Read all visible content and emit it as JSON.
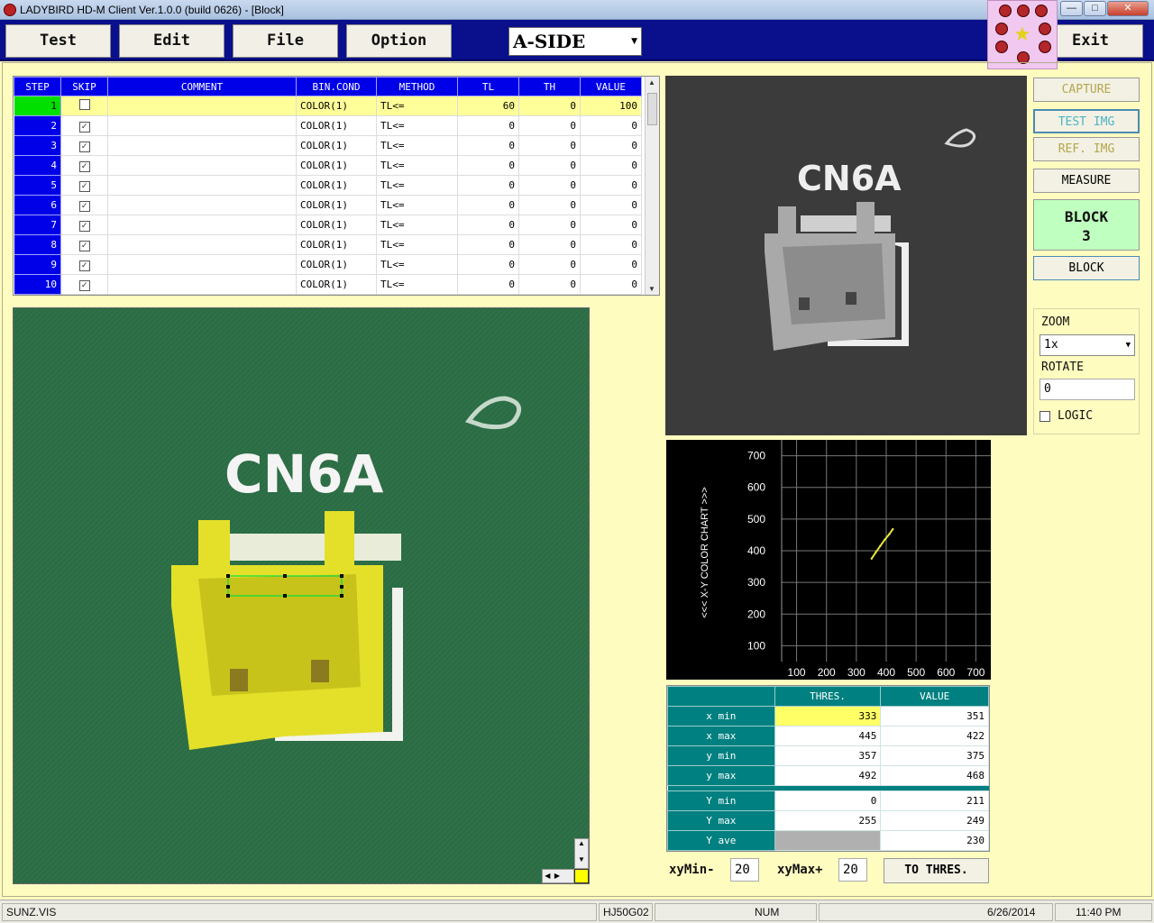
{
  "window": {
    "title": "LADYBIRD HD-M Client Ver.1.0.0  (build 0626) - [Block]",
    "minimize": "—",
    "maximize": "□",
    "close": "✕"
  },
  "toolbar": {
    "test": "Test",
    "edit": "Edit",
    "file": "File",
    "option": "Option",
    "side": "A-SIDE",
    "exit": "Exit"
  },
  "grid": {
    "headers": [
      "STEP",
      "SKIP",
      "COMMENT",
      "BIN.COND",
      "METHOD",
      "TL",
      "TH",
      "VALUE"
    ],
    "rows": [
      {
        "step": "1",
        "skip": false,
        "comment": "",
        "bin": "COLOR(1)",
        "method": "TL<=",
        "tl": "60",
        "th": "0",
        "value": "100"
      },
      {
        "step": "2",
        "skip": true,
        "comment": "",
        "bin": "COLOR(1)",
        "method": "TL<=",
        "tl": "0",
        "th": "0",
        "value": "0"
      },
      {
        "step": "3",
        "skip": true,
        "comment": "",
        "bin": "COLOR(1)",
        "method": "TL<=",
        "tl": "0",
        "th": "0",
        "value": "0"
      },
      {
        "step": "4",
        "skip": true,
        "comment": "",
        "bin": "COLOR(1)",
        "method": "TL<=",
        "tl": "0",
        "th": "0",
        "value": "0"
      },
      {
        "step": "5",
        "skip": true,
        "comment": "",
        "bin": "COLOR(1)",
        "method": "TL<=",
        "tl": "0",
        "th": "0",
        "value": "0"
      },
      {
        "step": "6",
        "skip": true,
        "comment": "",
        "bin": "COLOR(1)",
        "method": "TL<=",
        "tl": "0",
        "th": "0",
        "value": "0"
      },
      {
        "step": "7",
        "skip": true,
        "comment": "",
        "bin": "COLOR(1)",
        "method": "TL<=",
        "tl": "0",
        "th": "0",
        "value": "0"
      },
      {
        "step": "8",
        "skip": true,
        "comment": "",
        "bin": "COLOR(1)",
        "method": "TL<=",
        "tl": "0",
        "th": "0",
        "value": "0"
      },
      {
        "step": "9",
        "skip": true,
        "comment": "",
        "bin": "COLOR(1)",
        "method": "TL<=",
        "tl": "0",
        "th": "0",
        "value": "0"
      },
      {
        "step": "10",
        "skip": true,
        "comment": "",
        "bin": "COLOR(1)",
        "method": "TL<=",
        "tl": "0",
        "th": "0",
        "value": "0"
      }
    ]
  },
  "images": {
    "silkscreen": "CN6A"
  },
  "side_panel": {
    "capture": "CAPTURE",
    "test_img": "TEST IMG",
    "ref_img": "REF. IMG",
    "measure": "MEASURE",
    "block_label": "BLOCK",
    "block_number": "3",
    "block_button": "BLOCK",
    "zoom_label": "ZOOM",
    "zoom_value": "1x",
    "rotate_label": "ROTATE",
    "rotate_value": "0",
    "logic_label": "LOGIC",
    "logic_checked": false
  },
  "chart_data": {
    "type": "scatter",
    "title": "",
    "ylabel": "<<<  X-Y COLOR CHART  >>>",
    "xlabel": "",
    "xlim": [
      100,
      700
    ],
    "ylim": [
      100,
      700
    ],
    "x_ticks": [
      "100",
      "200",
      "300",
      "400",
      "500",
      "600",
      "700"
    ],
    "y_ticks": [
      "100",
      "200",
      "300",
      "400",
      "500",
      "600",
      "700"
    ],
    "grid": true,
    "series": [
      {
        "color": "#e8e83a",
        "points": [
          [
            351,
            375
          ],
          [
            365,
            395
          ],
          [
            380,
            415
          ],
          [
            395,
            435
          ],
          [
            410,
            452
          ],
          [
            422,
            468
          ]
        ]
      }
    ]
  },
  "thres_table": {
    "headers": [
      "",
      "THRES.",
      "VALUE"
    ],
    "rows": [
      {
        "label": "x min",
        "thres": "333",
        "value": "351",
        "highlight": true
      },
      {
        "label": "x max",
        "thres": "445",
        "value": "422"
      },
      {
        "label": "y min",
        "thres": "357",
        "value": "375"
      },
      {
        "label": "y max",
        "thres": "492",
        "value": "468"
      },
      {
        "label": "Y min",
        "thres": "0",
        "value": "211"
      },
      {
        "label": "Y max",
        "thres": "255",
        "value": "249"
      },
      {
        "label": "Y ave",
        "thres": "",
        "value": "230",
        "grey": true
      }
    ]
  },
  "xy_controls": {
    "min_label": "xyMin-",
    "min_value": "20",
    "max_label": "xyMax+",
    "max_value": "20",
    "to_thres": "TO THRES."
  },
  "status": {
    "file": "SUNZ.VIS",
    "model": "HJ50G02",
    "num": "NUM",
    "date": "6/26/2014",
    "time": "11:40 PM"
  }
}
